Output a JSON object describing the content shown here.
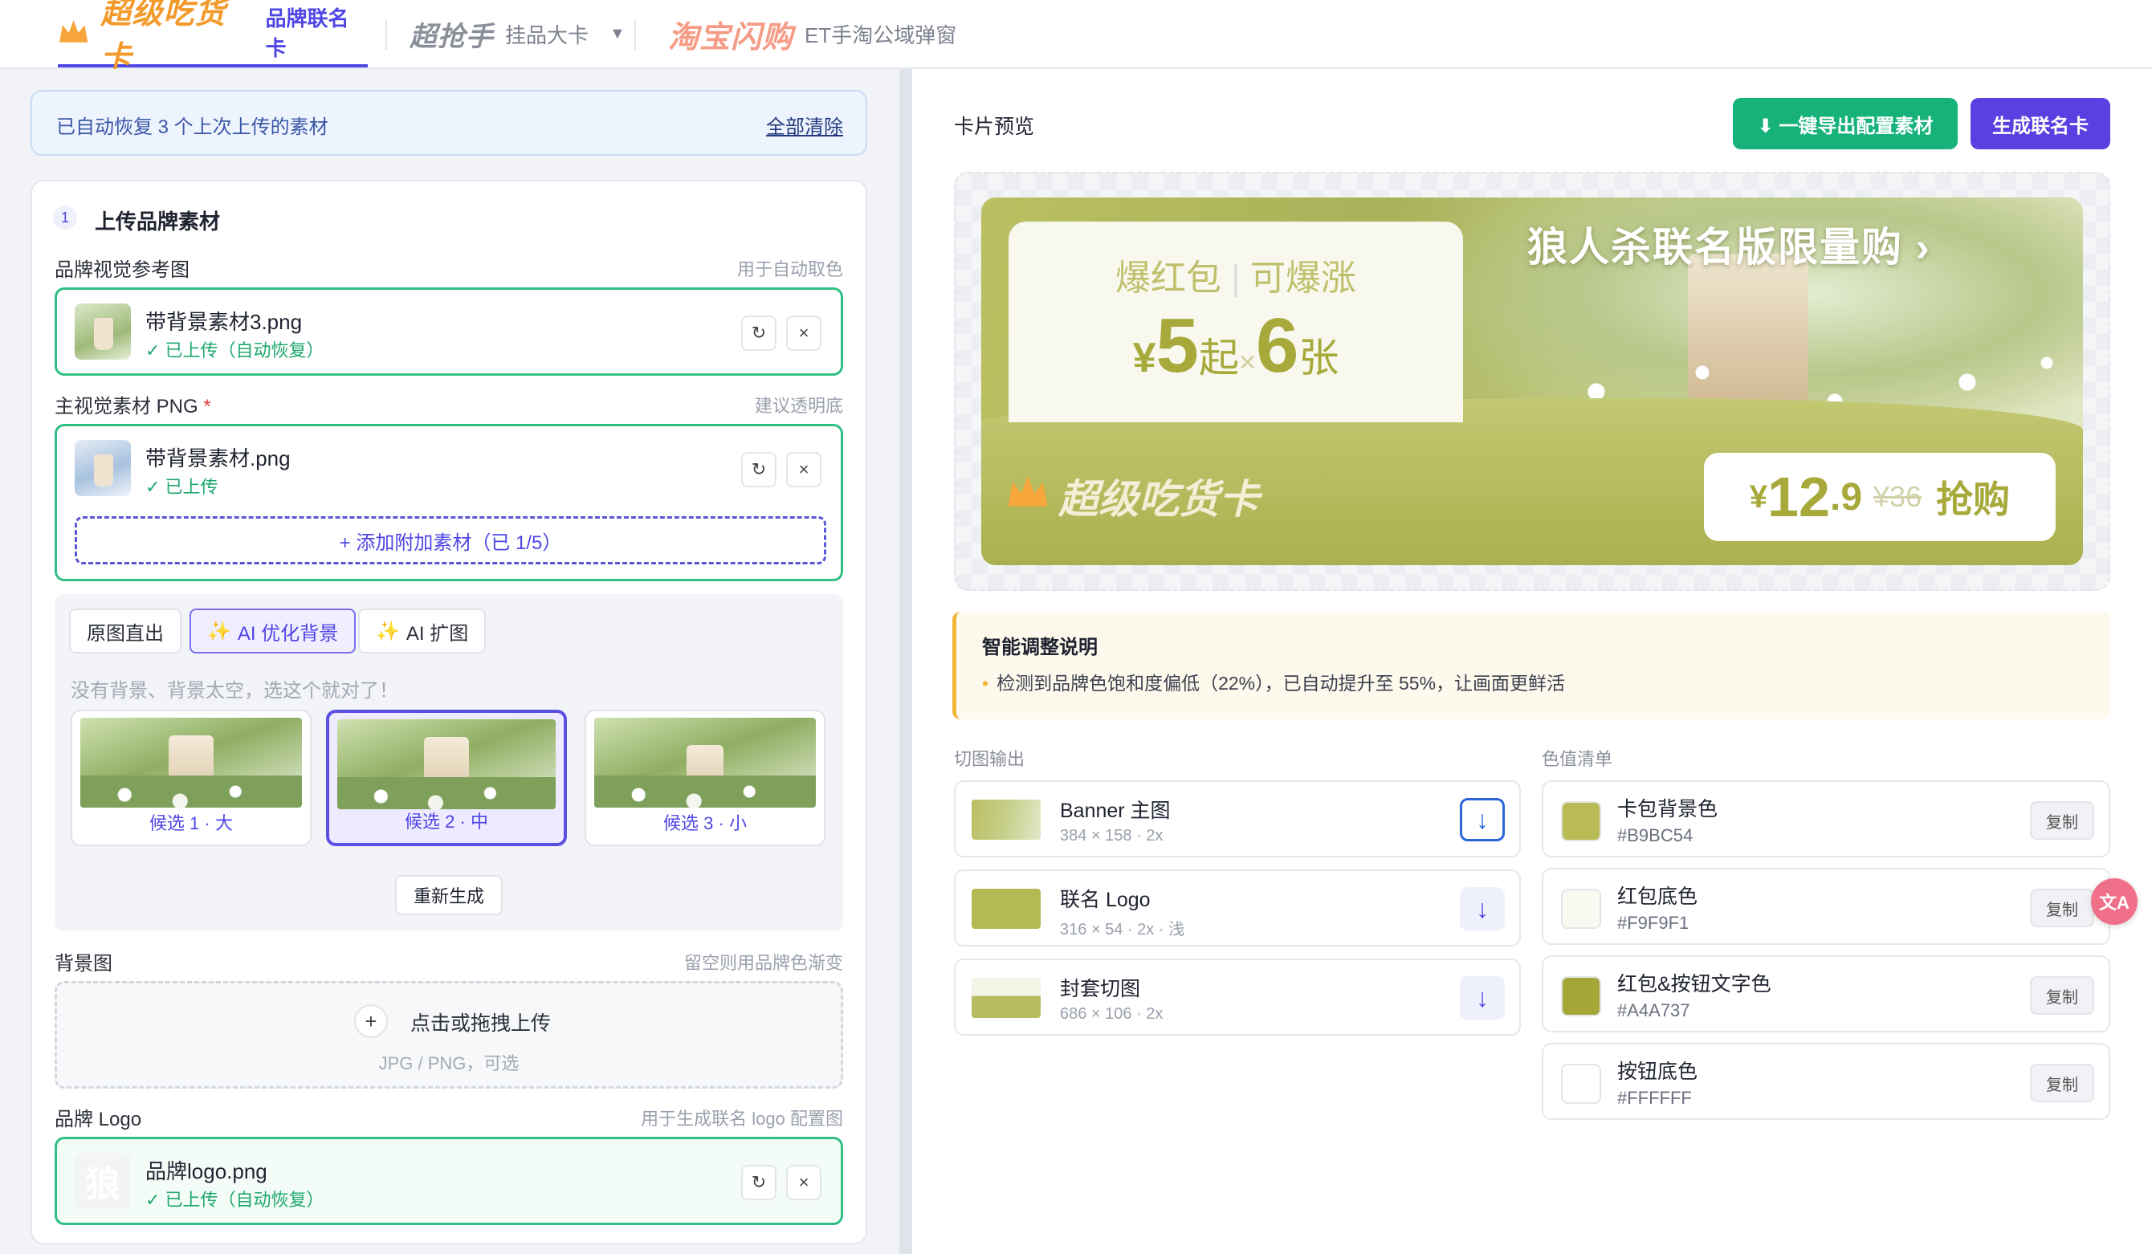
{
  "nav": {
    "tab1": {
      "brand": "超级吃货卡",
      "sub": "品牌联名卡"
    },
    "tab2": {
      "brand": "超抢手",
      "sub": "挂品大卡",
      "caret": "▼"
    },
    "tab3": {
      "brand": "淘宝闪购",
      "sub": "ET手淘公域弹窗"
    }
  },
  "restore": {
    "text": "已自动恢复 3 个上次上传的素材",
    "clear": "全部清除"
  },
  "step": {
    "num": "1",
    "title": "上传品牌素材"
  },
  "visual_ref": {
    "label": "品牌视觉参考图",
    "hint": "用于自动取色",
    "file": "带背景素材3.png",
    "status": "✓ 已上传（自动恢复）"
  },
  "main_visual": {
    "label": "主视觉素材 PNG",
    "req": "*",
    "hint": "建议透明底",
    "file": "带背景素材.png",
    "status": "✓ 已上传",
    "add": "+ 添加附加素材（已 1/5）"
  },
  "modes": {
    "m1": "原图直出",
    "m2": "AI 优化背景",
    "m3": "AI 扩图",
    "spark": "✨",
    "tip": "没有背景、背景太空，选这个就对了！"
  },
  "candidates": [
    "候选 1 · 大",
    "候选 2 · 中",
    "候选 3 · 小"
  ],
  "regen": "重新生成",
  "bg": {
    "label": "背景图",
    "hint": "留空则用品牌色渐变",
    "plus": "+",
    "upload": "点击或拖拽上传",
    "formats": "JPG / PNG，可选"
  },
  "logo": {
    "label": "品牌 Logo",
    "hint": "用于生成联名 logo 配置图",
    "file": "品牌logo.png",
    "status": "✓ 已上传（自动恢复）",
    "thumb_char": "狼"
  },
  "icons": {
    "refresh": "↻",
    "close": "×"
  },
  "right": {
    "title": "卡片预览",
    "export": "⬇ 一键导出配置素材",
    "generate": "生成联名卡"
  },
  "card": {
    "headline": "狼人杀联名版限量购 ›",
    "tag1": "爆红包",
    "tag2": "可爆涨",
    "yen": "¥",
    "price_from": "5",
    "qi": "起",
    "times": "×",
    "count": "6",
    "zhang": "张",
    "brand": "超级吃货卡",
    "btn_yen": "¥",
    "btn_int": "12",
    "btn_dec": ".9",
    "btn_old": "¥36",
    "btn_text": "抢购"
  },
  "note": {
    "title": "智能调整说明",
    "item": "检测到品牌色饱和度偏低（22%），已自动提升至 55%，让画面更鲜活"
  },
  "output": {
    "label": "切图输出",
    "items": [
      {
        "name": "Banner 主图",
        "size": "384 × 158 · 2x"
      },
      {
        "name": "联名 Logo",
        "size": "316 × 54 · 2x · 浅"
      },
      {
        "name": "封套切图",
        "size": "686 × 106 · 2x"
      }
    ],
    "dl": "↓"
  },
  "colors": {
    "label": "色值清单",
    "copy": "复制",
    "items": [
      {
        "name": "卡包背景色",
        "hex": "#B9BC54"
      },
      {
        "name": "红包底色",
        "hex": "#F9F9F1"
      },
      {
        "name": "红包&按钮文字色",
        "hex": "#A4A737"
      },
      {
        "name": "按钮底色",
        "hex": "#FFFFFF"
      }
    ]
  },
  "float_icon": "文A"
}
